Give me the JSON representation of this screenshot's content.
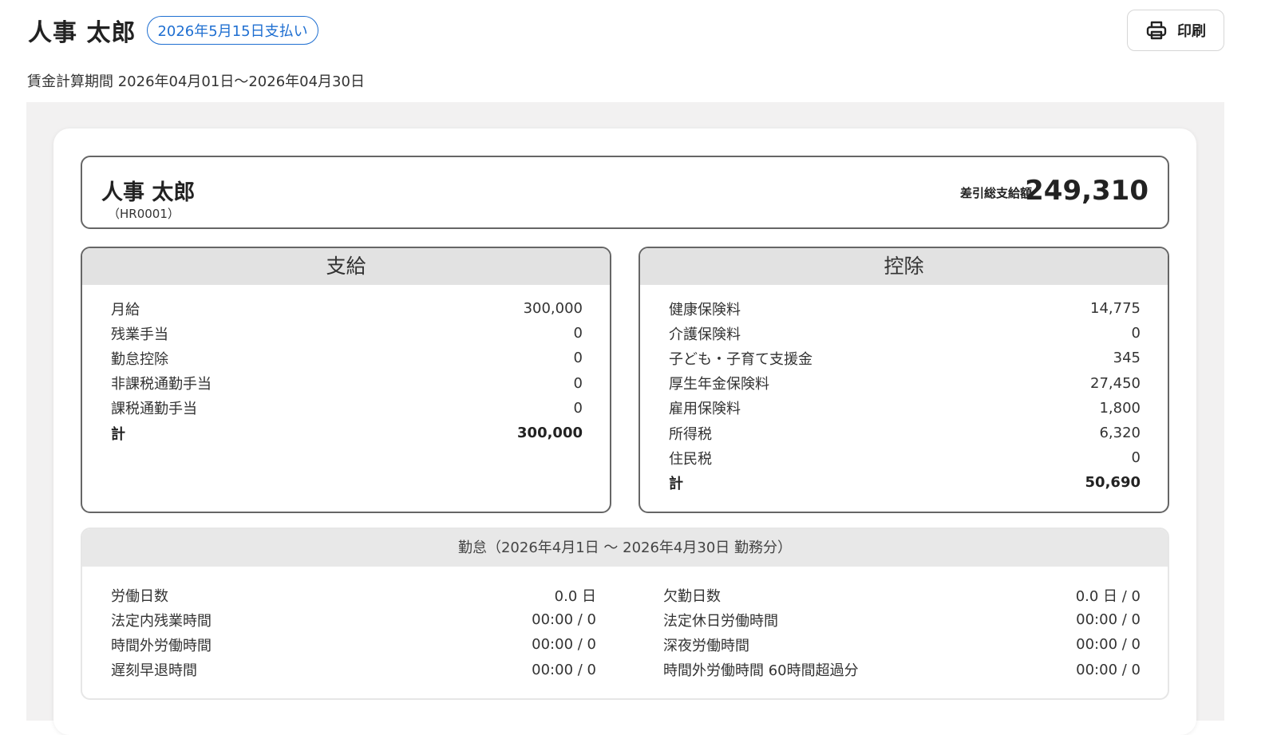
{
  "header": {
    "employee_name": "人事 太郎",
    "pay_date_badge": "2026年5月15日支払い",
    "print_label": "印刷",
    "period_label": "賃金計算期間 2026年04月01日〜2026年04月30日"
  },
  "summary": {
    "name": "人事 太郎",
    "code": "（HR0001）",
    "net_label": "差引総支給額",
    "net_value": "249,310"
  },
  "payments": {
    "title": "支給",
    "items": [
      {
        "label": "月給",
        "value": "300,000"
      },
      {
        "label": "残業手当",
        "value": "0"
      },
      {
        "label": "勤怠控除",
        "value": "0"
      },
      {
        "label": "非課税通勤手当",
        "value": "0"
      },
      {
        "label": "課税通勤手当",
        "value": "0"
      }
    ],
    "total_label": "計",
    "total_value": "300,000"
  },
  "deductions": {
    "title": "控除",
    "items": [
      {
        "label": "健康保険料",
        "value": "14,775"
      },
      {
        "label": "介護保険料",
        "value": "0"
      },
      {
        "label": "子ども・子育て支援金",
        "value": "345"
      },
      {
        "label": "厚生年金保険料",
        "value": "27,450"
      },
      {
        "label": "雇用保険料",
        "value": "1,800"
      },
      {
        "label": "所得税",
        "value": "6,320"
      },
      {
        "label": "住民税",
        "value": "0"
      }
    ],
    "total_label": "計",
    "total_value": "50,690"
  },
  "attendance": {
    "title": "勤怠（2026年4月1日 〜 2026年4月30日 勤務分）",
    "left": [
      {
        "label": "労働日数",
        "value": "0.0 日"
      },
      {
        "label": "法定内残業時間",
        "value": "00:00 / 0"
      },
      {
        "label": "時間外労働時間",
        "value": "00:00 / 0"
      },
      {
        "label": "遅刻早退時間",
        "value": "00:00 / 0"
      }
    ],
    "right": [
      {
        "label": "欠勤日数",
        "value": "0.0 日 / 0"
      },
      {
        "label": "法定休日労働時間",
        "value": "00:00 / 0"
      },
      {
        "label": "深夜労働時間",
        "value": "00:00 / 0"
      },
      {
        "label": "時間外労働時間 60時間超過分",
        "value": "00:00 / 0"
      }
    ]
  },
  "colors": {
    "badge_blue": "#1f6fd1",
    "panel_header": "#e2e2e2",
    "canvas_bg": "#f2f1f1"
  },
  "icons": {
    "print": "printer-icon"
  }
}
